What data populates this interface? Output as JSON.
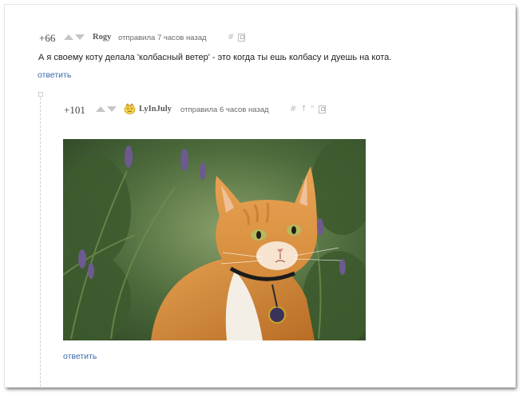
{
  "comment1": {
    "rating": "+66",
    "username": "Rogy",
    "time": "отправила 7 часов назад",
    "hash": "#",
    "text": "А я своему коту делала 'колбасный ветер' - это когда ты ешь колбасу и дуешь на кота.",
    "reply_label": "ответить"
  },
  "comment2": {
    "rating": "+101",
    "username": "LyInJuly",
    "time": "отправила 6 часов назад",
    "hash": "#",
    "reply_label": "ответить"
  },
  "colors": {
    "reply_link": "#3a69a8",
    "vote_arrow": "#c6c6c6",
    "text": "#222222"
  }
}
